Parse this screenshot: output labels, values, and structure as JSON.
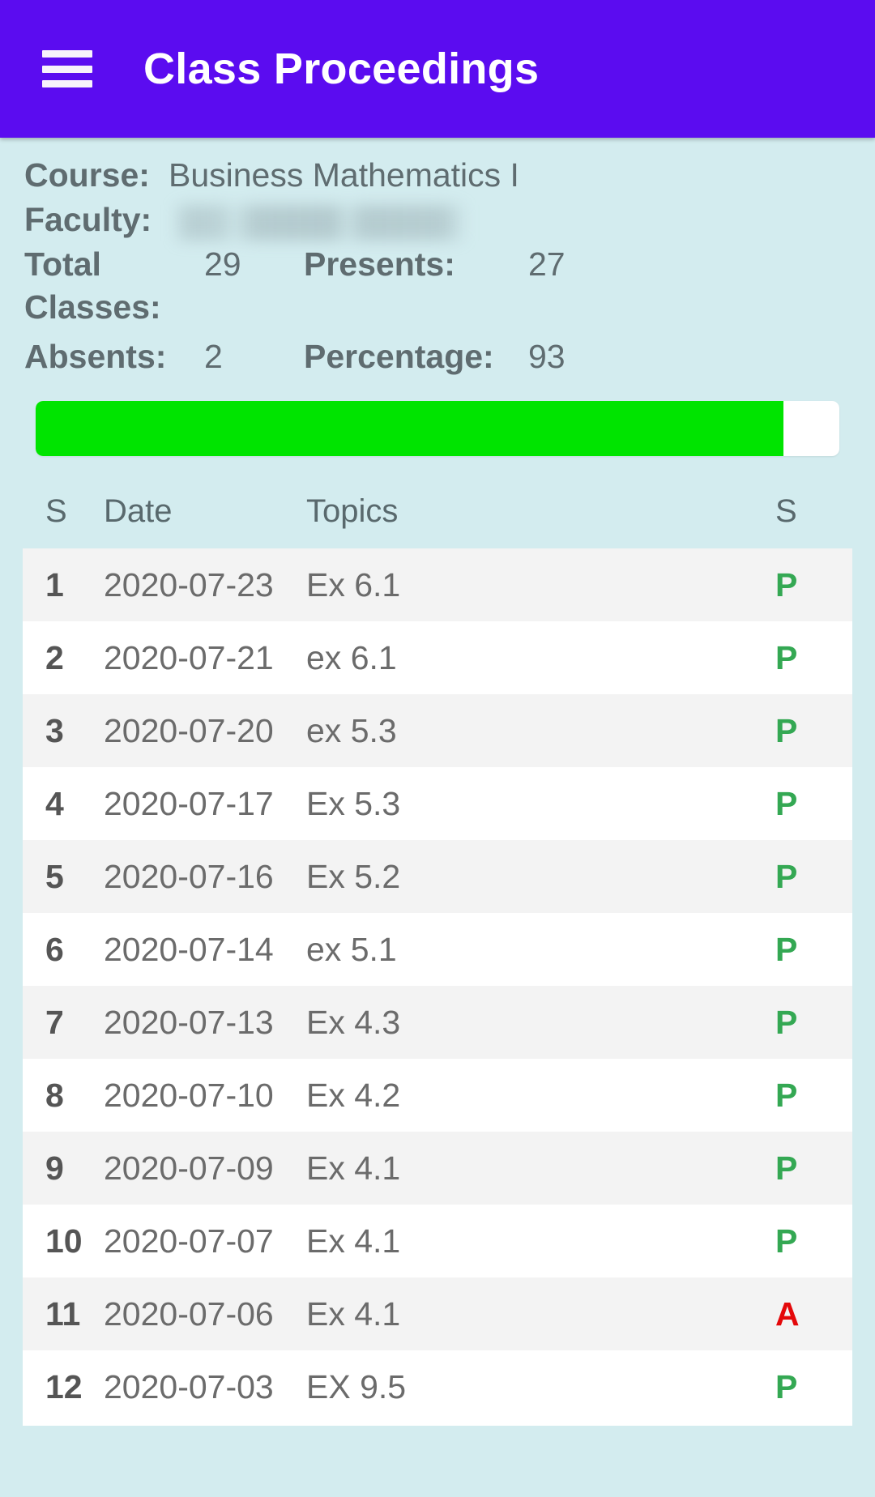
{
  "appbar": {
    "menu_icon": "hamburger-menu-icon",
    "title": "Class Proceedings"
  },
  "info": {
    "course_label": "Course:",
    "course_value": "Business Mathematics I",
    "faculty_label": "Faculty:",
    "faculty_value": "",
    "total_classes_label": "Total Classes:",
    "total_classes_value": "29",
    "presents_label": "Presents:",
    "presents_value": "27",
    "absents_label": "Absents:",
    "absents_value": "2",
    "percentage_label": "Percentage:",
    "percentage_value": "93"
  },
  "progress": {
    "percent": 93,
    "fill_color": "#00e400",
    "track_color": "#ffffff"
  },
  "table": {
    "headers": {
      "sn": "S",
      "date": "Date",
      "topics": "Topics",
      "status": "S"
    },
    "rows": [
      {
        "sn": "1",
        "date": "2020-07-23",
        "topic": "Ex 6.1",
        "status": "P"
      },
      {
        "sn": "2",
        "date": "2020-07-21",
        "topic": "ex 6.1",
        "status": "P"
      },
      {
        "sn": "3",
        "date": "2020-07-20",
        "topic": "ex 5.3",
        "status": "P"
      },
      {
        "sn": "4",
        "date": "2020-07-17",
        "topic": "Ex 5.3",
        "status": "P"
      },
      {
        "sn": "5",
        "date": "2020-07-16",
        "topic": "Ex 5.2",
        "status": "P"
      },
      {
        "sn": "6",
        "date": "2020-07-14",
        "topic": "ex 5.1",
        "status": "P"
      },
      {
        "sn": "7",
        "date": "2020-07-13",
        "topic": "Ex 4.3",
        "status": "P"
      },
      {
        "sn": "8",
        "date": "2020-07-10",
        "topic": "Ex 4.2",
        "status": "P"
      },
      {
        "sn": "9",
        "date": "2020-07-09",
        "topic": "Ex 4.1",
        "status": "P"
      },
      {
        "sn": "10",
        "date": "2020-07-07",
        "topic": "Ex 4.1",
        "status": "P"
      },
      {
        "sn": "11",
        "date": "2020-07-06",
        "topic": "Ex 4.1",
        "status": "A"
      },
      {
        "sn": "12",
        "date": "2020-07-03",
        "topic": "EX 9.5",
        "status": "P"
      }
    ]
  },
  "colors": {
    "appbar": "#5b0cf0",
    "page_background": "#d3ecef",
    "present": "#34a853",
    "absent": "#e4080a"
  }
}
